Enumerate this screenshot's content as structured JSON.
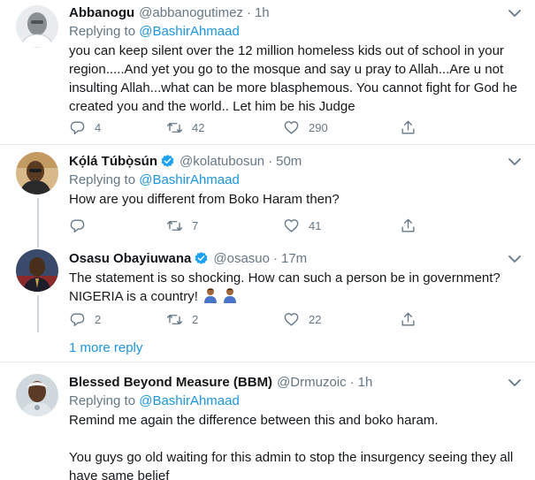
{
  "tweets": [
    {
      "name": "Abbanogu",
      "handle": "@abbanogutimez",
      "dot": "·",
      "time": "1h",
      "verified": false,
      "replying_prefix": "Replying to",
      "replying_to": "@BashirAhmaad",
      "text": "you can keep silent over the 12 million homeless kids out of school in your region.....And yet you go to the mosque and say u pray to Allah...Are u not insulting Allah...what can be more blasphemous. You cannot fight for God he created you and the world.. Let him be his Judge",
      "replies": "4",
      "retweets": "42",
      "likes": "290"
    },
    {
      "name": "Kọ́lá Túbọ̀sún",
      "handle": "@kolatubosun",
      "dot": "·",
      "time": "50m",
      "verified": true,
      "replying_prefix": "Replying to",
      "replying_to": "@BashirAhmaad",
      "text": "How are you different from Boko Haram then?",
      "replies": "",
      "retweets": "7",
      "likes": "41"
    },
    {
      "name": "Osasu Obayiuwana",
      "handle": "@osasuo",
      "dot": "·",
      "time": "17m",
      "verified": true,
      "text_line1": "The statement is so shocking. How can such a person be in government?",
      "text_line2": "NIGERIA is a country!",
      "replies": "2",
      "retweets": "2",
      "likes": "22"
    },
    {
      "name": "Blessed Beyond Measure (BBM)",
      "handle": "@Drmuzoic",
      "dot": "·",
      "time": "1h",
      "verified": false,
      "replying_prefix": "Replying to",
      "replying_to": "@BashirAhmaad",
      "text_p1": "Remind me again the difference between this and boko haram.",
      "text_p2": "You guys go old waiting for this admin to stop the insurgency seeing they all have same belief"
    }
  ],
  "more_replies": "1 more reply",
  "colors": {
    "link_blue": "#1b95e0",
    "verified_blue": "#1da1f2",
    "muted_gray": "#657786",
    "divider": "#e6ecf0",
    "thread_line": "#ccd6dd"
  },
  "icons": [
    "caret-down-icon",
    "reply-icon",
    "retweet-icon",
    "like-icon",
    "share-icon",
    "verified-badge-icon",
    "man-emoji-icon"
  ]
}
